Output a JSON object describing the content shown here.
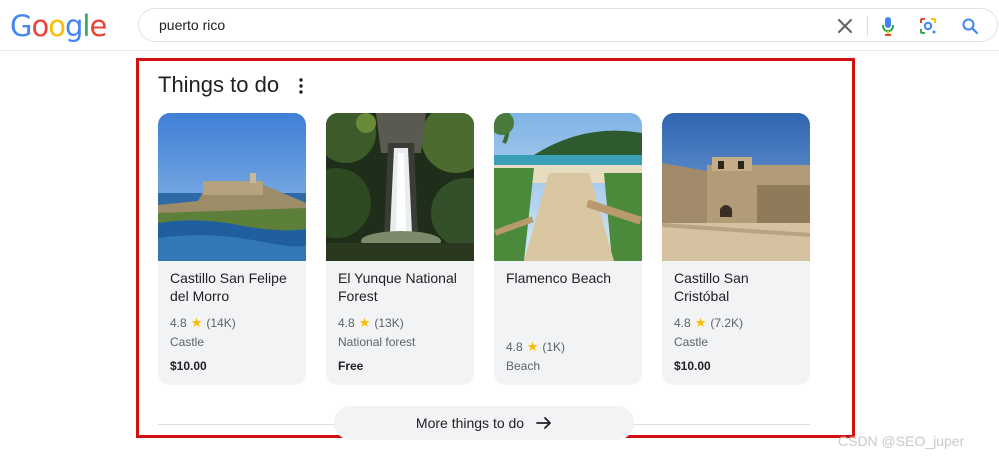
{
  "header": {
    "logo_letters": [
      "G",
      "o",
      "o",
      "g",
      "l",
      "e"
    ],
    "search_query": "puerto rico"
  },
  "section": {
    "title": "Things to do"
  },
  "cards": [
    {
      "title": "Castillo San Felipe del Morro",
      "rating": "4.8",
      "reviews": "(14K)",
      "type": "Castle",
      "price": "$10.00"
    },
    {
      "title": "El Yunque National Forest",
      "rating": "4.8",
      "reviews": "(13K)",
      "type": "National forest",
      "price": "Free"
    },
    {
      "title": "Flamenco Beach",
      "rating": "4.8",
      "reviews": "(1K)",
      "type": "Beach",
      "price": ""
    },
    {
      "title": "Castillo San Cristóbal",
      "rating": "4.8",
      "reviews": "(7.2K)",
      "type": "Castle",
      "price": "$10.00"
    }
  ],
  "more_button": {
    "label": "More things to do"
  },
  "watermark": "CSDN @SEO_juper",
  "colors": {
    "logo_blue": "#4285f4",
    "logo_red": "#ea4335",
    "logo_yellow": "#fbbc05",
    "logo_green": "#34a853",
    "highlight_red": "#d21010",
    "star": "#fbbc04"
  },
  "icons": [
    "clear-icon",
    "mic-icon",
    "lens-icon",
    "search-icon",
    "more-vert-icon",
    "star-icon",
    "arrow-right-icon"
  ]
}
